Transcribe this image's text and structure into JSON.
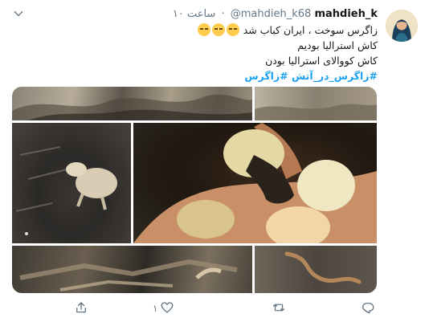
{
  "tweet": {
    "display_name": "mahdieh_k",
    "handle": "@mahdieh_k68",
    "separator": "·",
    "timestamp": "۱۰ ساعت",
    "lines": [
      "زاگرس سوخت ، ایران کباب شد",
      "کاش استرالیا بودیم",
      "کاش کووالای استرالیا بودن"
    ],
    "emoji_names": [
      "disappointed-relieved-face",
      "disappointed-relieved-face",
      "disappointed-relieved-face"
    ],
    "hashtags": [
      "#زاگرس_در_آتش",
      "#زاگرس"
    ],
    "media": [
      {
        "name": "burnt-rocks"
      },
      {
        "name": "burnt-ground"
      },
      {
        "name": "burnt-animal"
      },
      {
        "name": "hand-holding-eggs"
      },
      {
        "name": "burnt-branches"
      },
      {
        "name": "burnt-snake"
      }
    ]
  },
  "actions": {
    "reply_count": "۱",
    "retweet_count": "",
    "like_count": ""
  },
  "colors": {
    "link": "#1da1f2",
    "secondary_text": "#657786"
  }
}
